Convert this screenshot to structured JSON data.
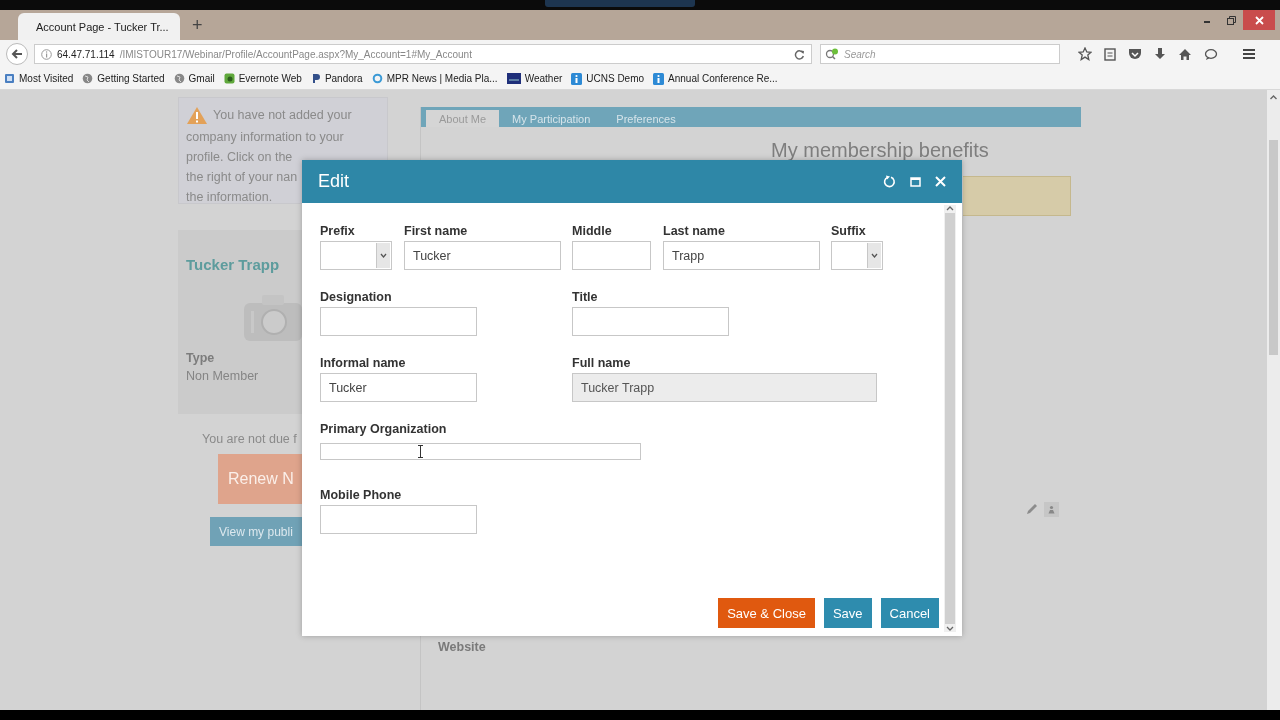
{
  "browser": {
    "tab_title": "Account Page - Tucker Tr...",
    "new_tab": "+",
    "url_host": "64.47.71.114",
    "url_path": "/IMISTOUR17/Webinar/Profile/AccountPage.aspx?My_Account=1#My_Account",
    "search_placeholder": "Search",
    "bookmarks": [
      {
        "label": "Most Visited",
        "kind": "folder"
      },
      {
        "label": "Getting Started",
        "kind": "globe"
      },
      {
        "label": "Gmail",
        "kind": "globe"
      },
      {
        "label": "Evernote Web",
        "kind": "evernote"
      },
      {
        "label": "Pandora",
        "kind": "pandora"
      },
      {
        "label": "MPR News | Media Pla...",
        "kind": "ring"
      },
      {
        "label": "Weather",
        "kind": "weather"
      },
      {
        "label": "UCNS Demo",
        "kind": "info"
      },
      {
        "label": "Annual Conference Re...",
        "kind": "info"
      }
    ]
  },
  "page": {
    "alert_lines": [
      "You have not added your",
      "company information to your",
      "profile. Click on the",
      "the right of your nan",
      "the information."
    ],
    "profile_name": "Tucker Trapp",
    "type_label": "Type",
    "type_value": "Non Member",
    "dues_text": "You are not due f",
    "renew_button": "Renew N",
    "public_button": "View my publi",
    "tabs": [
      {
        "label": "About Me",
        "selected": true
      },
      {
        "label": "My Participation",
        "selected": false
      },
      {
        "label": "Preferences",
        "selected": false
      }
    ],
    "benefits_title": "My membership benefits",
    "website_label": "Website"
  },
  "dialog": {
    "title": "Edit",
    "rows": [
      {
        "fields": [
          {
            "label": "Prefix",
            "kind": "select",
            "disabled": false
          },
          {
            "label": "First name",
            "kind": "text",
            "value": "Tucker",
            "disabled": false
          },
          {
            "label": "Middle",
            "kind": "text",
            "disabled": false
          },
          {
            "label": "Last name",
            "kind": "text",
            "value": "Trapp",
            "disabled": false
          },
          {
            "label": "Suffix",
            "kind": "select",
            "disabled": false
          }
        ]
      },
      {
        "fields": [
          {
            "label": "Designation",
            "kind": "text",
            "disabled": false
          },
          {
            "label": "Title",
            "kind": "text",
            "disabled": false
          }
        ]
      },
      {
        "fields": [
          {
            "label": "Informal name",
            "kind": "text",
            "value": "Tucker",
            "disabled": false
          },
          {
            "label": "Full name",
            "kind": "text",
            "value": "Tucker Trapp",
            "disabled": true
          }
        ]
      },
      {
        "fields": [
          {
            "label": "Primary Organization",
            "kind": "text",
            "disabled": false
          }
        ]
      },
      {
        "fields": [
          {
            "label": "Mobile Phone",
            "kind": "text",
            "disabled": false
          }
        ]
      }
    ],
    "buttons": [
      {
        "label": "Save & Close",
        "kind": "primary"
      },
      {
        "label": "Save",
        "kind": "secondary"
      },
      {
        "label": "Cancel",
        "kind": "secondary"
      }
    ]
  }
}
